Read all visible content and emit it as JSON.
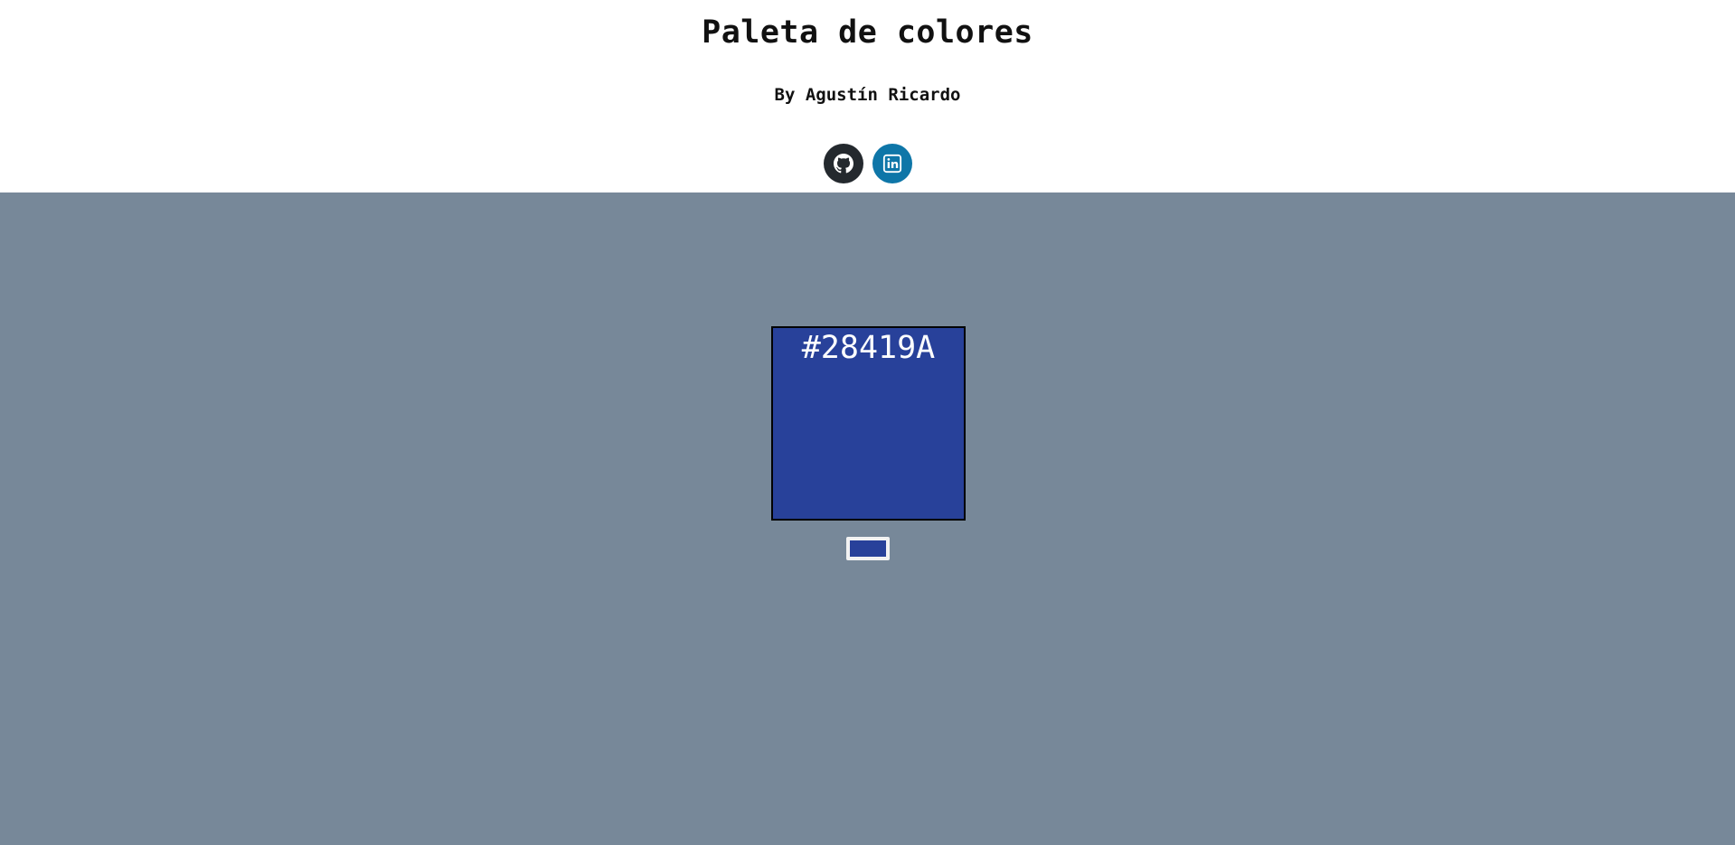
{
  "header": {
    "title": "Paleta de colores",
    "byline": "By Agustín Ricardo",
    "social": [
      {
        "name": "github",
        "icon": "github-icon",
        "color": "#24292e"
      },
      {
        "name": "linkedin",
        "icon": "linkedin-icon",
        "color": "#0e76a8"
      }
    ]
  },
  "palette": {
    "background_color": "#778899",
    "selected_color": "#28419A",
    "color_code": "#28419A"
  }
}
